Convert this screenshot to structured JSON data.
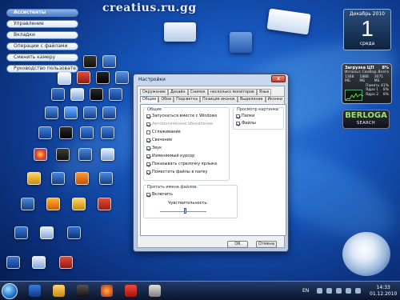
{
  "watermark": "creatius.ru.gg",
  "side_menu": {
    "header": "Ассистенты",
    "items": [
      "Управление",
      "Вкладки",
      "Операции с файлами",
      "Сменить камеру",
      "Руководство пользовате..."
    ]
  },
  "calendar": {
    "month": "Декабрь 2010",
    "day": "1",
    "weekday": "среда"
  },
  "cpu_gadget": {
    "title": "Загрузка ЦП",
    "value": "8%",
    "rows": [
      [
        "Использ.",
        "Свобод.",
        "Всего"
      ],
      [
        "1368 МБ",
        "1888 МБ",
        "3071 МБ"
      ],
      [
        "",
        "Память",
        "41%"
      ],
      [
        "",
        "Ядро 1",
        "8%"
      ],
      [
        "",
        "Ядро 2",
        "8%"
      ]
    ]
  },
  "berloga": {
    "logo": "BERLOGA",
    "sub": "SEARCH"
  },
  "dialog": {
    "title": "Настройки",
    "close": "x",
    "tabs_top": [
      "Окружение",
      "Дизайн",
      "Снимок",
      "несколько мониторов",
      "Язык"
    ],
    "tabs_bottom": [
      "Общие",
      "Обои",
      "Подсветка",
      "Позиция иконок",
      "Выделение",
      "Иконки"
    ],
    "general_group": {
      "title": "Общие",
      "options": [
        {
          "label": "Запускаться вместе с Windows",
          "checked": true,
          "disabled": false
        },
        {
          "label": "Автоматическое обновление",
          "checked": true,
          "disabled": true
        },
        {
          "label": "Сглаживание",
          "checked": false,
          "disabled": false
        },
        {
          "label": "Свечение",
          "checked": true,
          "disabled": false
        },
        {
          "label": "Звук",
          "checked": true,
          "disabled": false
        },
        {
          "label": "Изменяемый курсор",
          "checked": true,
          "disabled": false
        },
        {
          "label": "Показывать стрелочку ярлыка",
          "checked": true,
          "disabled": false
        },
        {
          "label": "Поместить файлы в папку",
          "checked": true,
          "disabled": false
        }
      ]
    },
    "preview_group": {
      "title": "Просмотр картинки",
      "options": [
        {
          "label": "Папки",
          "checked": true
        },
        {
          "label": "Файлы",
          "checked": true
        }
      ]
    },
    "hide_group": {
      "title": "Прятать имена файлов:",
      "enable_label": "Включить",
      "enable_checked": true,
      "sensitivity_label": "Чувствительность:"
    },
    "ok": "OK",
    "cancel": "Отмена"
  },
  "taskbar": {
    "lang": "EN",
    "time": "14:33",
    "date": "01.12.2010"
  }
}
